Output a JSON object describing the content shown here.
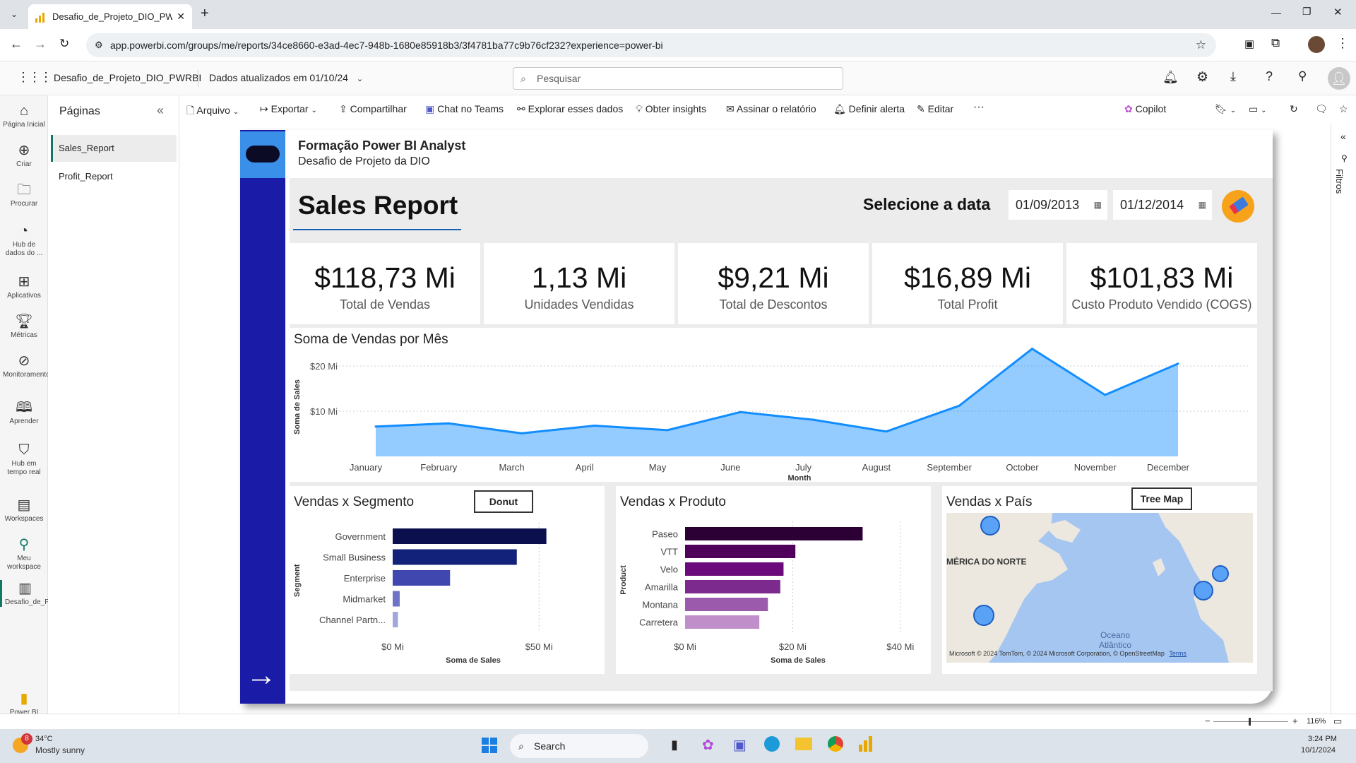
{
  "browser": {
    "tab_title": "Desafio_de_Projeto_DIO_PWRBI",
    "url": "app.powerbi.com/groups/me/reports/34ce8660-e3ad-4ec7-948b-1680e85918b3/3f4781ba77c9b76cf232?experience=power-bi"
  },
  "pbi_header": {
    "report_name": "Desafio_de_Projeto_DIO_PWRBI",
    "data_updated": "Dados atualizados em 01/10/24",
    "search_placeholder": "Pesquisar"
  },
  "left_nav": [
    {
      "label": "Página Inicial",
      "icon": "home-icon"
    },
    {
      "label": "Criar",
      "icon": "plus-icon"
    },
    {
      "label": "Procurar",
      "icon": "folder-icon"
    },
    {
      "label": "Hub de dados do ...",
      "icon": "data-hub-icon"
    },
    {
      "label": "Aplicativos",
      "icon": "apps-icon"
    },
    {
      "label": "Métricas",
      "icon": "trophy-icon"
    },
    {
      "label": "Monitoramento",
      "icon": "monitor-icon"
    },
    {
      "label": "Aprender",
      "icon": "book-icon"
    },
    {
      "label": "Hub em tempo real",
      "icon": "realtime-icon"
    },
    {
      "label": "Workspaces",
      "icon": "workspaces-icon"
    },
    {
      "label": "Meu workspace",
      "icon": "person-icon"
    },
    {
      "label": "Desafio_de_Projeto_DI...",
      "icon": "report-icon"
    }
  ],
  "power_bi_label": "Power BI",
  "pages_panel": {
    "title": "Páginas",
    "items": [
      "Sales_Report",
      "Profit_Report"
    ]
  },
  "toolbar": {
    "arquivo": "Arquivo",
    "exportar": "Exportar",
    "compartilhar": "Compartilhar",
    "chat_teams": "Chat no Teams",
    "explorar": "Explorar esses dados",
    "insights": "Obter insights",
    "assinar": "Assinar o relatório",
    "alerta": "Definir alerta",
    "editar": "Editar",
    "more": "···",
    "copilot": "Copilot"
  },
  "report": {
    "header_title": "Formação Power BI Analyst",
    "header_subtitle": "Desafio de Projeto da DIO",
    "page_title": "Sales Report",
    "date_label": "Selecione a data",
    "date_start": "01/09/2013",
    "date_end": "01/12/2014",
    "kpis": [
      {
        "value": "$118,73 Mi",
        "label": "Total de Vendas"
      },
      {
        "value": "1,13 Mi",
        "label": "Unidades Vendidas"
      },
      {
        "value": "$9,21 Mi",
        "label": "Total de Descontos"
      },
      {
        "value": "$16,89 Mi",
        "label": "Total Profit"
      },
      {
        "value": "$101,83 Mi",
        "label": "Custo Produto Vendido (COGS)"
      }
    ],
    "map": {
      "title": "Vendas x País",
      "button": "Tree Map",
      "region_label": "MÉRICA DO NORTE",
      "ocean_label_1": "Oceano",
      "ocean_label_2": "Atlântico",
      "attribution": "© 2024 TomTom, © 2024 Microsoft Corporation, © OpenStreetMap",
      "terms": "Terms",
      "brand": "Microsoft"
    }
  },
  "chart_data": [
    {
      "type": "area",
      "title": "Soma de Vendas por Mês",
      "xlabel": "Month",
      "ylabel": "Soma de Sales",
      "categories": [
        "January",
        "February",
        "March",
        "April",
        "May",
        "June",
        "July",
        "August",
        "September",
        "October",
        "November",
        "December"
      ],
      "values": [
        6.6,
        7.3,
        5.1,
        6.8,
        5.8,
        9.8,
        8.1,
        5.5,
        11.2,
        23.8,
        13.6,
        20.5
      ],
      "y_ticks": [
        "$10 Mi",
        "$20 Mi"
      ],
      "ylim": [
        0,
        25
      ],
      "color": "#118dff"
    },
    {
      "type": "bar",
      "title": "Vendas x Segmento",
      "button": "Donut",
      "xlabel": "Soma de Sales",
      "ylabel": "Segment",
      "categories": [
        "Government",
        "Small Business",
        "Enterprise",
        "Midmarket",
        "Channel Partn..."
      ],
      "values": [
        52.5,
        42.4,
        19.6,
        2.4,
        1.8
      ],
      "x_ticks": [
        "$0 Mi",
        "$50 Mi"
      ],
      "xlim": [
        0,
        55
      ],
      "colors": [
        "#0b0f4d",
        "#12217a",
        "#4048b0",
        "#6e73c6",
        "#a3a6dd"
      ]
    },
    {
      "type": "bar",
      "title": "Vendas x Produto",
      "xlabel": "Soma de Sales",
      "ylabel": "Product",
      "categories": [
        "Paseo",
        "VTT",
        "Velo",
        "Amarilla",
        "Montana",
        "Carretera"
      ],
      "values": [
        33.0,
        20.5,
        18.3,
        17.7,
        15.4,
        13.8
      ],
      "x_ticks": [
        "$0 Mi",
        "$20 Mi",
        "$40 Mi"
      ],
      "xlim": [
        0,
        42
      ],
      "colors": [
        "#2d0035",
        "#4e005a",
        "#6b0a7a",
        "#7d2a8e",
        "#9b5aab",
        "#c08fc9"
      ]
    }
  ],
  "status_bar": {
    "zoom": "116%"
  },
  "taskbar": {
    "weather_temp": "34°C",
    "weather_desc": "Mostly sunny",
    "weather_badge": "8",
    "search": "Search",
    "time": "3:24 PM",
    "date": "10/1/2024"
  }
}
